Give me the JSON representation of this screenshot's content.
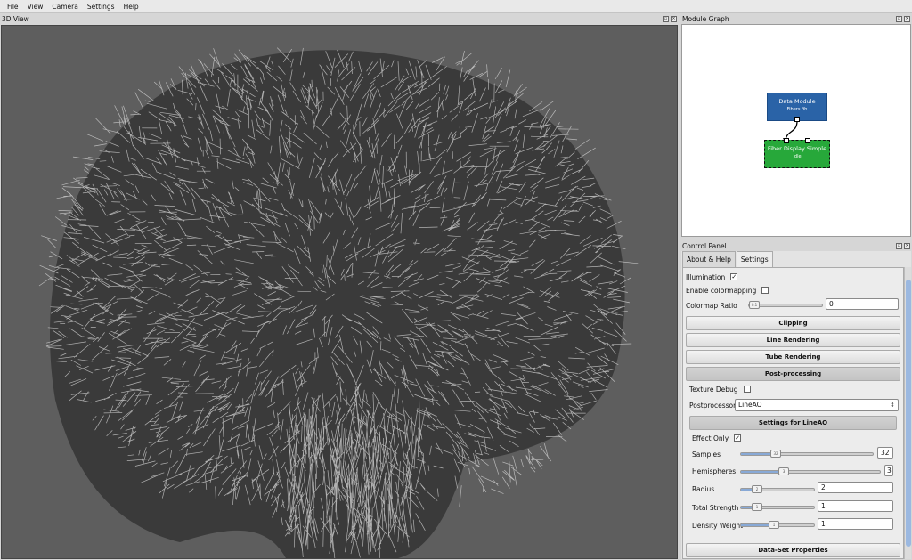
{
  "menu": [
    "File",
    "View",
    "Camera",
    "Settings",
    "Help"
  ],
  "view3d": {
    "title": "3D View"
  },
  "graph": {
    "title": "Module Graph",
    "nodes": [
      {
        "name": "Data Module",
        "status": "Fibers.fib"
      },
      {
        "name": "Fiber Display Simple",
        "status": "Idle"
      }
    ]
  },
  "control_panel": {
    "title": "Control Panel",
    "tabs": [
      "About & Help",
      "Settings"
    ],
    "active_tab": "Settings",
    "illumination": {
      "label": "Illumination",
      "checked": true
    },
    "colormapping": {
      "label": "Enable colormapping",
      "checked": false
    },
    "colormap_ratio": {
      "label": "Colormap Ratio",
      "value": "0",
      "fraction": 0.0
    },
    "sections": {
      "clipping": "Clipping",
      "line_rendering": "Line Rendering",
      "tube_rendering": "Tube Rendering",
      "post_processing": "Post-processing",
      "dataset_properties": "Data-Set Properties"
    },
    "texture_debug": {
      "label": "Texture Debug",
      "checked": false
    },
    "postprocessor": {
      "label": "Postprocessor",
      "value": "LineAO"
    },
    "lineao": {
      "title": "Settings for LineAO",
      "effect_only": {
        "label": "Effect Only",
        "checked": true
      },
      "samples": {
        "label": "Samples",
        "value": "32",
        "fraction": 0.25
      },
      "hemispheres": {
        "label": "Hemispheres",
        "value": "3",
        "fraction": 0.3
      },
      "radius": {
        "label": "Radius",
        "value": "2",
        "fraction": 0.1
      },
      "total_strength": {
        "label": "Total Strength",
        "value": "1",
        "fraction": 0.1
      },
      "density_weight": {
        "label": "Density Weight",
        "value": "1",
        "fraction": 0.3
      }
    }
  },
  "colors": {
    "view_bg": "#5e5e5e",
    "data_node": "#2a63a7",
    "fiber_node": "#27a83a",
    "slider_fill": "#88a9d6"
  }
}
